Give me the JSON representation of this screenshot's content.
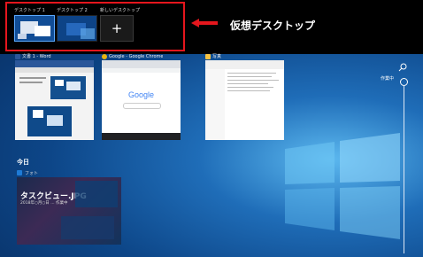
{
  "desktops": {
    "items": [
      {
        "label": "デスクトップ 1",
        "active": true
      },
      {
        "label": "デスクトップ 2",
        "active": false
      }
    ],
    "new_label": "新しいデスクトップ",
    "new_symbol": "+"
  },
  "annotation": {
    "text": "仮想デスクトップ",
    "highlight_color": "#e5161d"
  },
  "windows": [
    {
      "title": "文書 1 - Word",
      "icon": "word-icon",
      "icon_color": "#2b579a"
    },
    {
      "title": "Google - Google Chrome",
      "icon": "chrome-icon",
      "icon_color": "#e8b30f"
    },
    {
      "title": "写真",
      "icon": "folder-icon",
      "icon_color": "#f6c342"
    }
  ],
  "chrome_page": {
    "logo": "Google"
  },
  "timeline": {
    "section_label": "今日",
    "entry": {
      "app": "フォト",
      "title": "タスクビュー.JPG",
      "meta": "2018年○月○日 ... 作業中"
    }
  },
  "rail": {
    "label": "作業中"
  }
}
